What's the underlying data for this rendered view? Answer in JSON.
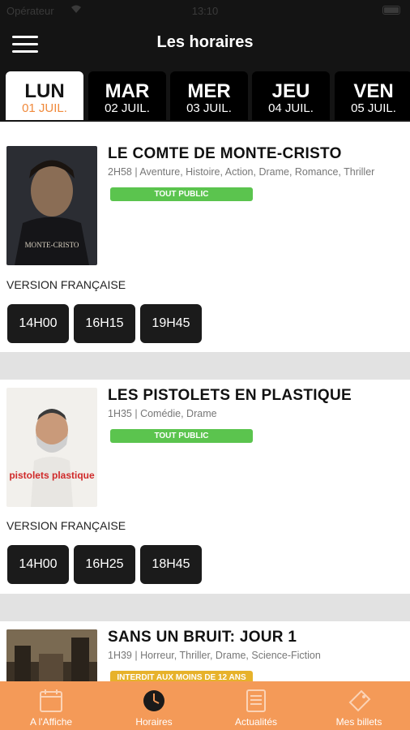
{
  "status_bar": {
    "carrier": "Opérateur",
    "time": "13:10"
  },
  "header": {
    "title": "Les horaires"
  },
  "days": [
    {
      "name": "LUN",
      "date": "01 JUIL."
    },
    {
      "name": "MAR",
      "date": "02 JUIL."
    },
    {
      "name": "MER",
      "date": "03 JUIL."
    },
    {
      "name": "JEU",
      "date": "04 JUIL."
    },
    {
      "name": "VEN",
      "date": "05 JUIL."
    }
  ],
  "active_day": "LUN",
  "movies": [
    {
      "title": "LE COMTE DE MONTE-CRISTO",
      "meta": "2H58 | Aventure, Histoire, Action, Drame, Romance, Thriller",
      "rating": "TOUT PUBLIC",
      "version": "VERSION FRANÇAISE",
      "poster_text": "MONTE-CRISTO",
      "times": [
        "14H00",
        "16H15",
        "19H45"
      ]
    },
    {
      "title": "LES PISTOLETS EN PLASTIQUE",
      "meta": "1H35 | Comédie, Drame",
      "rating": "TOUT PUBLIC",
      "version": "VERSION FRANÇAISE",
      "poster_text": "pistolets plastique",
      "times": [
        "14H00",
        "16H25",
        "18H45"
      ]
    },
    {
      "title": "SANS UN BRUIT: JOUR 1",
      "meta": "1H39 | Horreur, Thriller, Drame, Science-Fiction",
      "rating": "INTERDIT AUX MOINS DE 12 ANS"
    }
  ],
  "tabs": [
    {
      "label": "A l'Affiche",
      "icon": "calendar-icon"
    },
    {
      "label": "Horaires",
      "icon": "clock-icon"
    },
    {
      "label": "Actualités",
      "icon": "news-icon"
    },
    {
      "label": "Mes billets",
      "icon": "ticket-icon"
    }
  ],
  "colors": {
    "accent": "#f49a58",
    "rating_green": "#5bc44e",
    "rating_yellow": "#e7b22b",
    "header_bg": "#141414"
  }
}
